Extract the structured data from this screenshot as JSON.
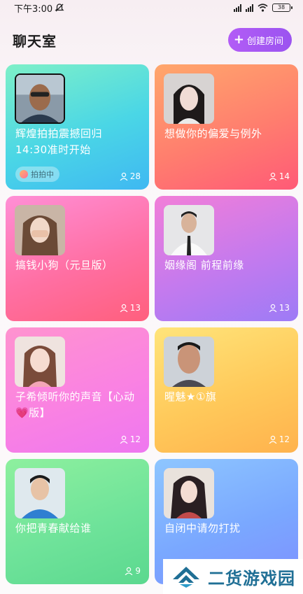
{
  "status_bar": {
    "time": "下午3:00",
    "battery": "38"
  },
  "header": {
    "title": "聊天室",
    "create_button": "创建房间"
  },
  "rooms": [
    {
      "title": "辉煌拍拍震撼回归\n14:30准时开始",
      "count": "28",
      "badge": "拍拍中"
    },
    {
      "title": "想做你的偏爱与例外",
      "count": "14"
    },
    {
      "title": "搞钱小狗（元旦版）",
      "count": "13"
    },
    {
      "title": "姻缘阁 前程前缘",
      "count": "13"
    },
    {
      "title": "子希倾听你的声音【心动💗版】",
      "count": "12"
    },
    {
      "title": "暒魅★①旗",
      "count": "12"
    },
    {
      "title": "你把青春献给谁",
      "count": "9"
    },
    {
      "title": "自闭中请勿打扰",
      "count": ""
    }
  ],
  "watermark": {
    "text": "二货游戏园"
  }
}
